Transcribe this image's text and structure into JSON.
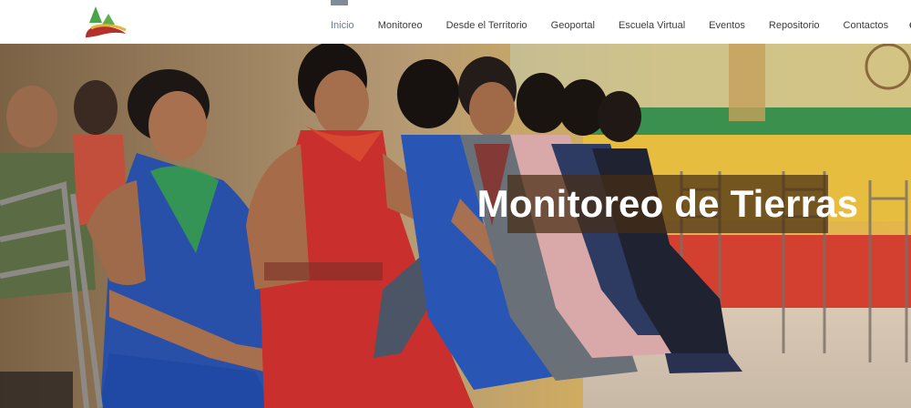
{
  "header": {
    "logo_name": "logo",
    "nav": [
      {
        "label": "Inicio",
        "active": true
      },
      {
        "label": "Monitoreo",
        "active": false
      },
      {
        "label": "Desde el Territorio",
        "active": false
      },
      {
        "label": "Geoportal",
        "active": false
      },
      {
        "label": "Escuela Virtual",
        "active": false
      },
      {
        "label": "Eventos",
        "active": false
      },
      {
        "label": "Repositorio",
        "active": false
      },
      {
        "label": "Contactos",
        "active": false
      }
    ],
    "search_icon": "search-icon"
  },
  "hero": {
    "title": "Monitoreo de Tierras"
  },
  "colors": {
    "nav_active": "#6b7f8e",
    "nav_text": "#3c3c3c",
    "title_bg": "#462d14"
  }
}
